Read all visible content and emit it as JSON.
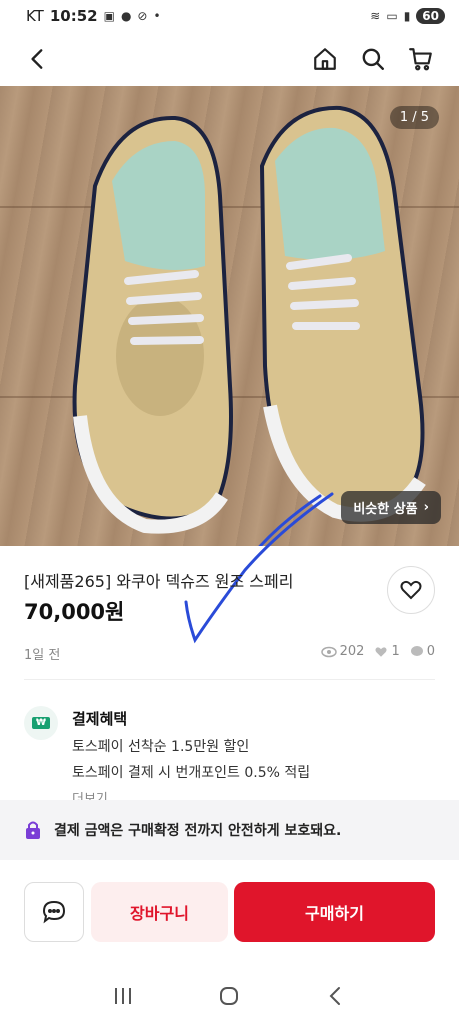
{
  "status": {
    "carrier": "KT",
    "time": "10:52",
    "battery": "60"
  },
  "hero": {
    "counter": "1 / 5",
    "similar_label": "비슷한 상품"
  },
  "product": {
    "title": "[새제품265] 와쿠아 덱슈즈 원조 스페리",
    "price": "70,000원",
    "posted": "1일 전",
    "views": "202",
    "likes": "1",
    "chats": "0"
  },
  "benefit": {
    "title": "결제혜택",
    "lines": [
      "토스페이 선착순 1.5만원 할인",
      "토스페이 결제 시 번개포인트 0.5% 적립"
    ],
    "more": "더보기"
  },
  "protect": {
    "text": "결제 금액은 구매확정 전까지 안전하게 보호돼요."
  },
  "actions": {
    "cart": "장바구니",
    "buy": "구매하기"
  },
  "colors": {
    "accent": "#e0152b",
    "accent_soft": "#fdeeee",
    "benefit_green": "#18a071"
  },
  "icons": [
    "back-icon",
    "home-icon",
    "search-icon",
    "cart-icon",
    "heart-icon",
    "eye-icon",
    "chat-bubble-icon",
    "lock-icon",
    "won-icon",
    "recents-icon",
    "home-circle-icon",
    "back-arrow-icon"
  ]
}
